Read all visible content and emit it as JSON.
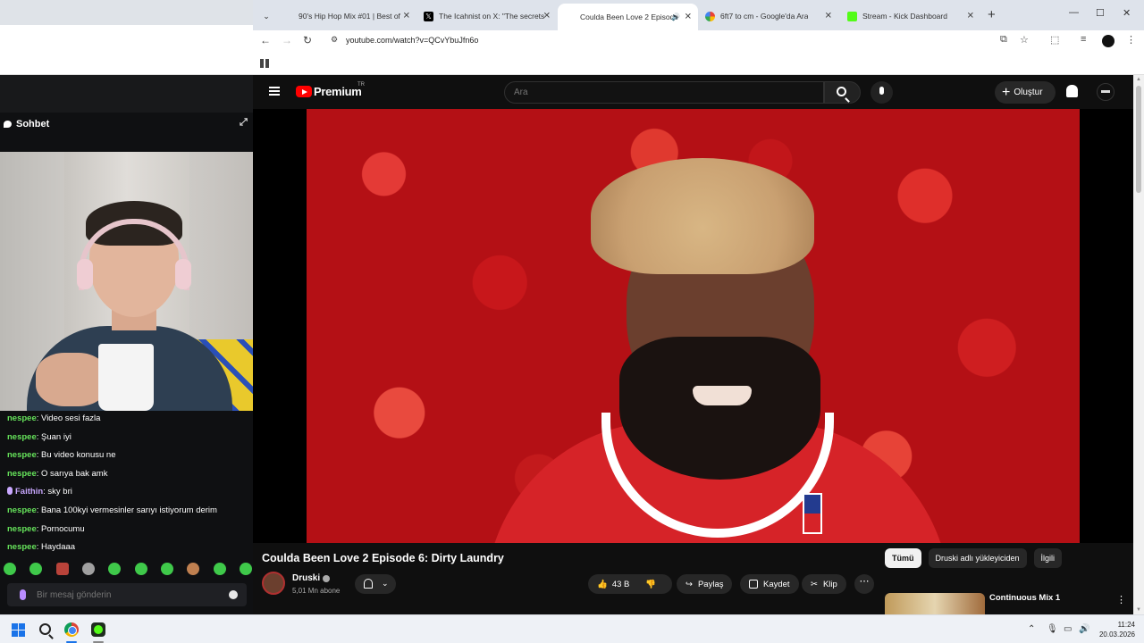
{
  "chat_panel": {
    "title": "Sohbet",
    "messages": [
      {
        "user": "nespee",
        "text": "Video sesi fazla"
      },
      {
        "user": "nespee",
        "text": "Şuan iyi"
      },
      {
        "user": "nespee",
        "text": "Bu video konusu ne"
      },
      {
        "user": "nespee",
        "text": "O sarıya bak amk"
      },
      {
        "user": "Faithin",
        "text": "sky bri"
      },
      {
        "user": "nespee",
        "text": "Bana 100kyi vermesinler sarıyı istiyorum derim"
      },
      {
        "user": "nespee",
        "text": "Pornocumu"
      },
      {
        "user": "nespee",
        "text": "Haydaaa"
      }
    ],
    "input_placeholder": "Bir mesaj gönderin"
  },
  "browser": {
    "tabs": [
      {
        "title": "90's Hip Hop Mix #01 | Best of",
        "icon": "youtube-icon"
      },
      {
        "title": "The Icahnist on X: \"The secrets",
        "icon": "x-icon"
      },
      {
        "title": "Coulda Been Love 2 Episode",
        "icon": "youtube-icon",
        "active": true,
        "audio": true
      },
      {
        "title": "6ft7 to cm - Google'da Ara",
        "icon": "google-icon"
      },
      {
        "title": "Stream - Kick Dashboard",
        "icon": "kick-icon"
      }
    ],
    "url": "youtube.com/watch?v=QCvYbuJfn6o"
  },
  "youtube": {
    "brand": "Premium",
    "country": "TR",
    "search_placeholder": "Ara",
    "create_label": "Oluştur",
    "video_title": "Coulda Been Love 2 Episode 6: Dirty Laundry",
    "channel_name": "Druski",
    "subscribers": "5,01 Mn abone",
    "likes": "43 B",
    "share_label": "Paylaş",
    "save_label": "Kaydet",
    "clip_label": "Klip",
    "chips": [
      "Tümü",
      "Druski adlı yükleyiciden",
      "İlgili"
    ],
    "recommendation_title": "Continuous Mix 1"
  },
  "taskbar": {
    "time": "11:24",
    "date": "20.03.2026"
  }
}
